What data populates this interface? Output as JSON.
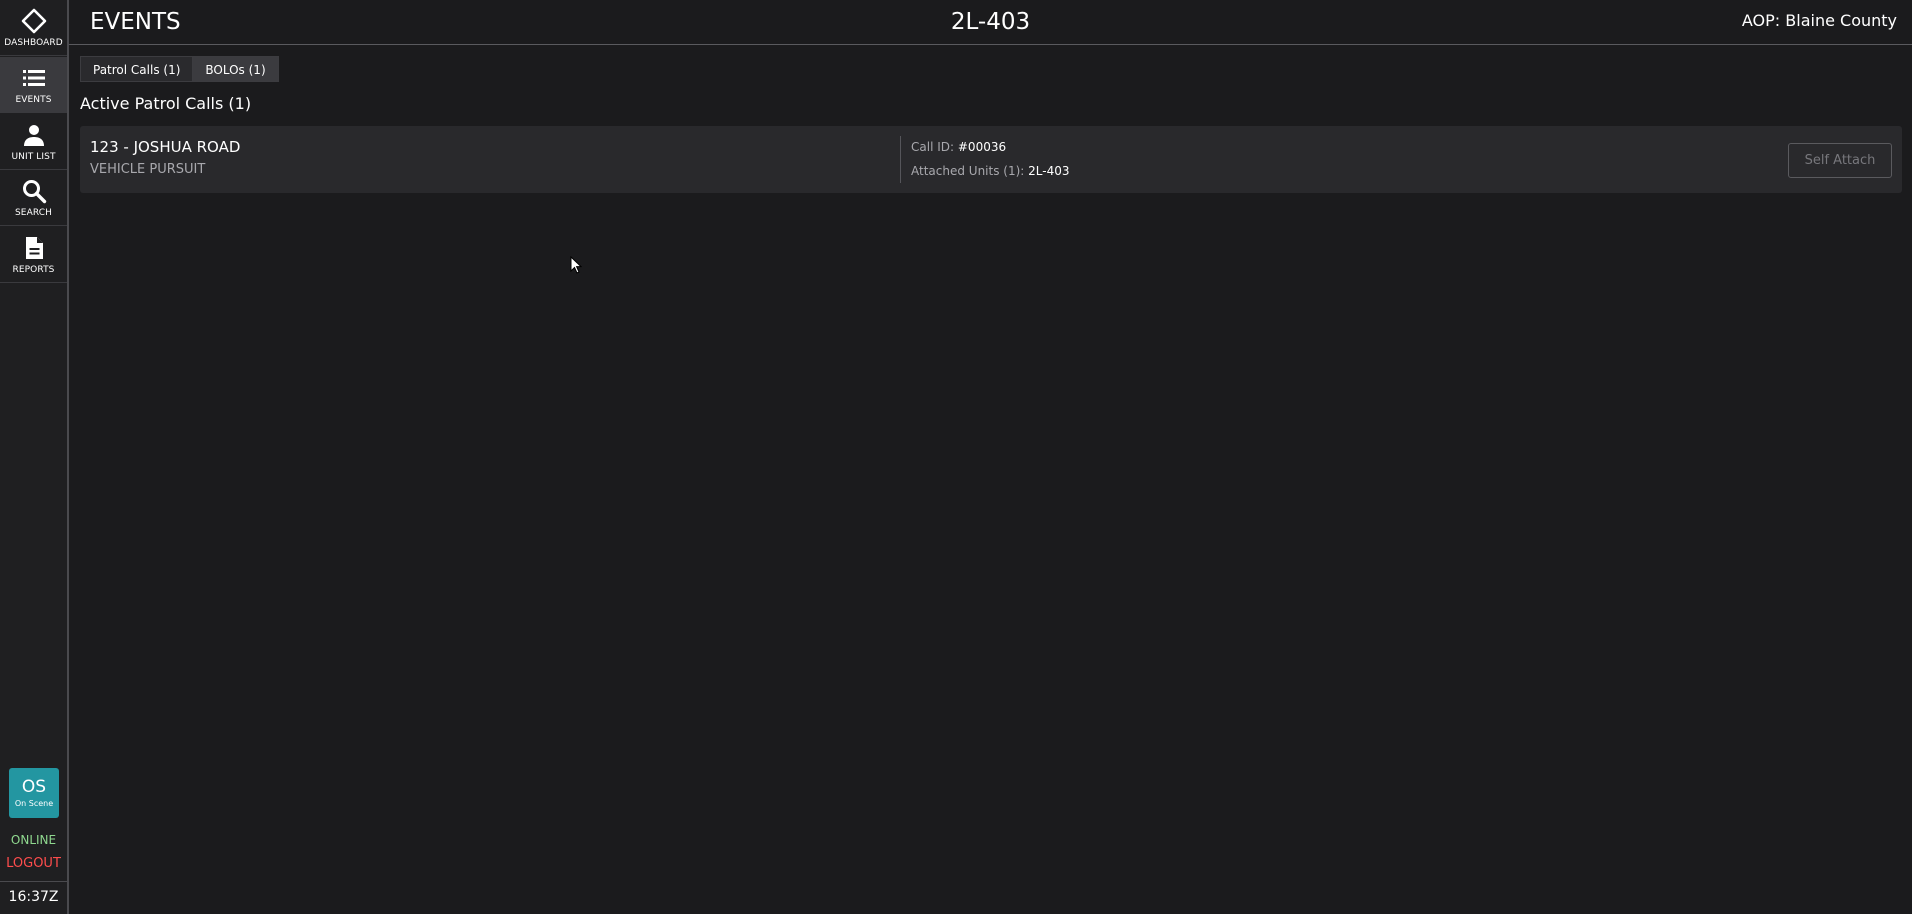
{
  "sidebar": {
    "items": [
      {
        "label": "DASHBOARD",
        "icon": "diamond-icon"
      },
      {
        "label": "EVENTS",
        "icon": "list-icon",
        "active": true
      },
      {
        "label": "UNIT LIST",
        "icon": "person-icon"
      },
      {
        "label": "SEARCH",
        "icon": "search-icon"
      },
      {
        "label": "REPORTS",
        "icon": "document-icon"
      }
    ],
    "status": {
      "code": "OS",
      "label": "On Scene",
      "color": "#2396a1"
    },
    "connection": "ONLINE",
    "logout": "LOGOUT",
    "clock": "16:37Z"
  },
  "header": {
    "title": "EVENTS",
    "unit": "2L-403",
    "aop": "AOP: Blaine County"
  },
  "tabs": [
    {
      "label": "Patrol Calls (1)",
      "active": true
    },
    {
      "label": "BOLOs (1)",
      "active": false
    }
  ],
  "section_title": "Active Patrol Calls (1)",
  "calls": [
    {
      "address": "123 - JOSHUA ROAD",
      "type": "VEHICLE PURSUIT",
      "call_id_label": "Call ID:",
      "call_id": "#00036",
      "attached_label": "Attached Units (1):",
      "attached_units": "2L-403",
      "action": "Self Attach"
    }
  ],
  "colors": {
    "background": "#1b1b1d",
    "card": "#29292c",
    "online": "#8fd88f",
    "logout": "#ff4d4d"
  }
}
